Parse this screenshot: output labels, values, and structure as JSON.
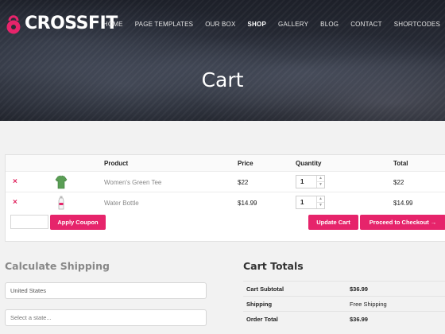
{
  "brand": {
    "name": "CROSSFIT",
    "accent": "#e6246b"
  },
  "nav": {
    "items": [
      {
        "label": "HOME",
        "active": false
      },
      {
        "label": "PAGE TEMPLATES",
        "active": false
      },
      {
        "label": "OUR BOX",
        "active": false
      },
      {
        "label": "SHOP",
        "active": true
      },
      {
        "label": "GALLERY",
        "active": false
      },
      {
        "label": "BLOG",
        "active": false
      },
      {
        "label": "CONTACT",
        "active": false
      },
      {
        "label": "SHORTCODES",
        "active": false
      }
    ]
  },
  "page_title": "Cart",
  "cart": {
    "headers": {
      "product": "Product",
      "price": "Price",
      "quantity": "Quantity",
      "total": "Total"
    },
    "items": [
      {
        "remove_icon": "×",
        "thumbnail": "green-tee-icon",
        "name": "Women's Green Tee",
        "price": "$22",
        "quantity": "1",
        "total": "$22"
      },
      {
        "remove_icon": "×",
        "thumbnail": "water-bottle-icon",
        "name": "Water Bottle",
        "price": "$14.99",
        "quantity": "1",
        "total": "$14.99"
      }
    ],
    "coupon_placeholder": "",
    "apply_coupon_label": "Apply Coupon",
    "update_cart_label": "Update Cart",
    "checkout_label": "Proceed to Checkout →"
  },
  "shipping": {
    "title": "Calculate Shipping",
    "country": "United States",
    "state_placeholder": "Select a state..."
  },
  "totals": {
    "title": "Cart Totals",
    "rows": [
      {
        "label": "Cart Subtotal",
        "value": "$36.99"
      },
      {
        "label": "Shipping",
        "value": "Free Shipping"
      },
      {
        "label": "Order Total",
        "value": "$36.99"
      }
    ]
  }
}
